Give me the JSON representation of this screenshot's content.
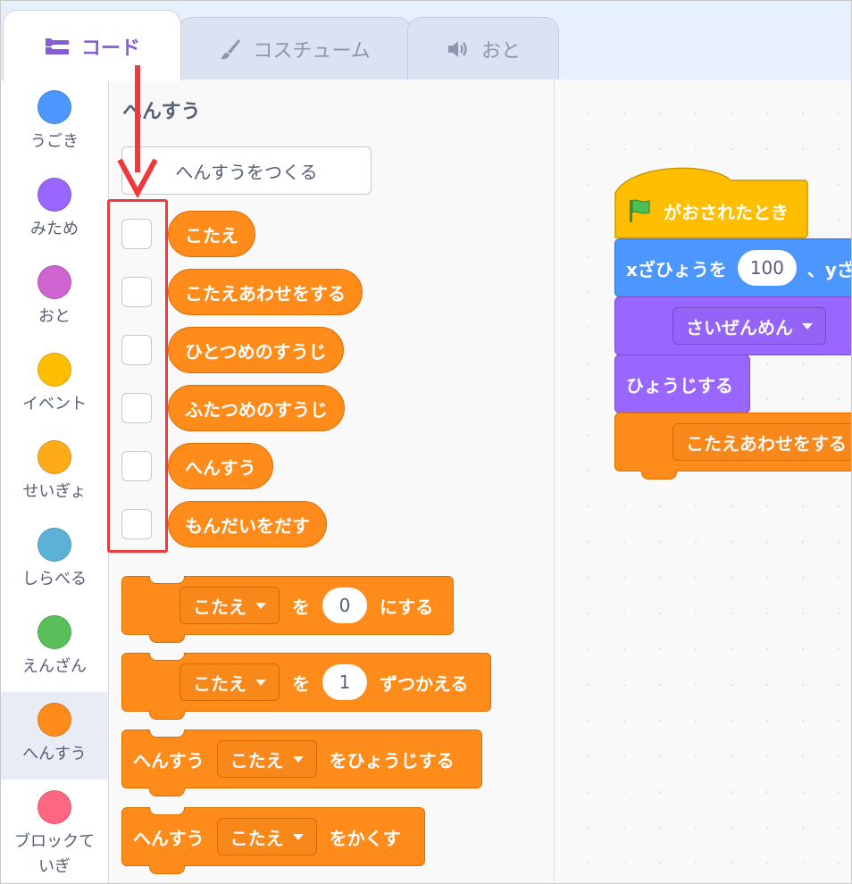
{
  "tabs": [
    {
      "label": "コード",
      "icon": "code-icon",
      "active": true
    },
    {
      "label": "コスチューム",
      "icon": "brush-icon",
      "active": false
    },
    {
      "label": "おと",
      "icon": "speaker-icon",
      "active": false
    }
  ],
  "categories": [
    {
      "label": "うごき",
      "color": "#4c97ff"
    },
    {
      "label": "みため",
      "color": "#9966ff"
    },
    {
      "label": "おと",
      "color": "#cf63cf"
    },
    {
      "label": "イベント",
      "color": "#ffbf00"
    },
    {
      "label": "せいぎょ",
      "color": "#ffab19"
    },
    {
      "label": "しらべる",
      "color": "#5cb1d6"
    },
    {
      "label": "えんざん",
      "color": "#59c059"
    },
    {
      "label": "へんすう",
      "color": "#ff8c1a",
      "selected": true
    },
    {
      "label1": "ブロックて",
      "label2": "いぎ",
      "color": "#ff6680"
    }
  ],
  "palette": {
    "title": "へんすう",
    "make_variable": "へんすうをつくる",
    "variables": [
      "こたえ",
      "こたえあわせをする",
      "ひとつめのすうじ",
      "ふたつめのすうじ",
      "へんすう",
      "もんだいをだす"
    ],
    "set_block": {
      "var": "こたえ",
      "to": "を",
      "value": "0",
      "suffix": "にする"
    },
    "change_block": {
      "var": "こたえ",
      "by": "を",
      "value": "1",
      "suffix": "ずつかえる"
    },
    "show_block": {
      "prefix": "へんすう",
      "var": "こたえ",
      "suffix": "をひょうじする"
    },
    "hide_block": {
      "prefix": "へんすう",
      "var": "こたえ",
      "suffix": "をかくす"
    }
  },
  "script": {
    "hat": "がおされたとき",
    "goto": {
      "label": "xざひょうを",
      "value": "100",
      "rest": "、yざ"
    },
    "backdrop": "さいぜんめん",
    "show": "ひょうじする",
    "call": "こたえあわせをする"
  },
  "colors": {
    "accent": "#855cd6",
    "variables": "#ff8c1a",
    "motion": "#4c97ff",
    "looks": "#9966ff",
    "events": "#ffbf00",
    "annotation": "#ee3a3a"
  }
}
